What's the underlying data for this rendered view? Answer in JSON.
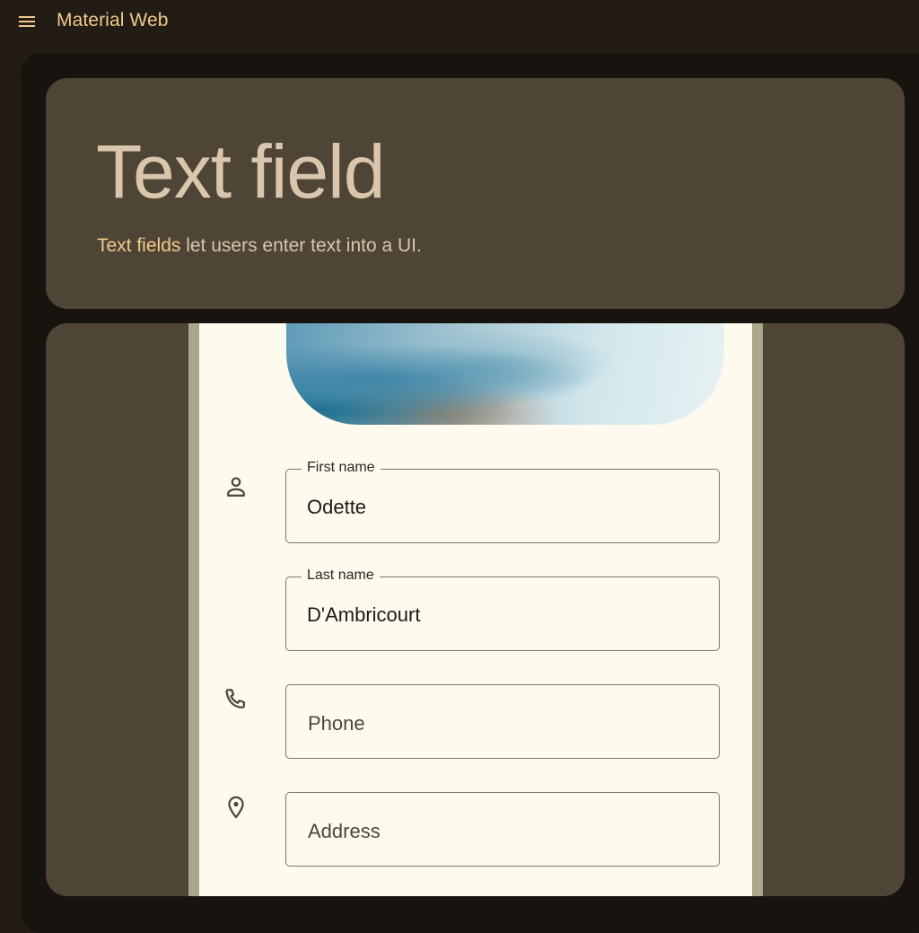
{
  "app": {
    "title": "Material Web",
    "menu_icon": "menu-icon"
  },
  "hero": {
    "title": "Text field",
    "desc_link": "Text fields",
    "desc_rest": " let users enter text into a UI."
  },
  "colors": {
    "accent": "#f2c98b",
    "background": "#221c15",
    "surface": "#4f4536",
    "phone_screen": "#fefaee"
  },
  "form": {
    "first_name": {
      "label": "First name",
      "value": "Odette",
      "icon": "person-icon"
    },
    "last_name": {
      "label": "Last name",
      "value": "D'Ambricourt"
    },
    "phone": {
      "placeholder": "Phone",
      "icon": "phone-icon"
    },
    "address": {
      "placeholder": "Address",
      "icon": "location-pin-icon"
    }
  }
}
